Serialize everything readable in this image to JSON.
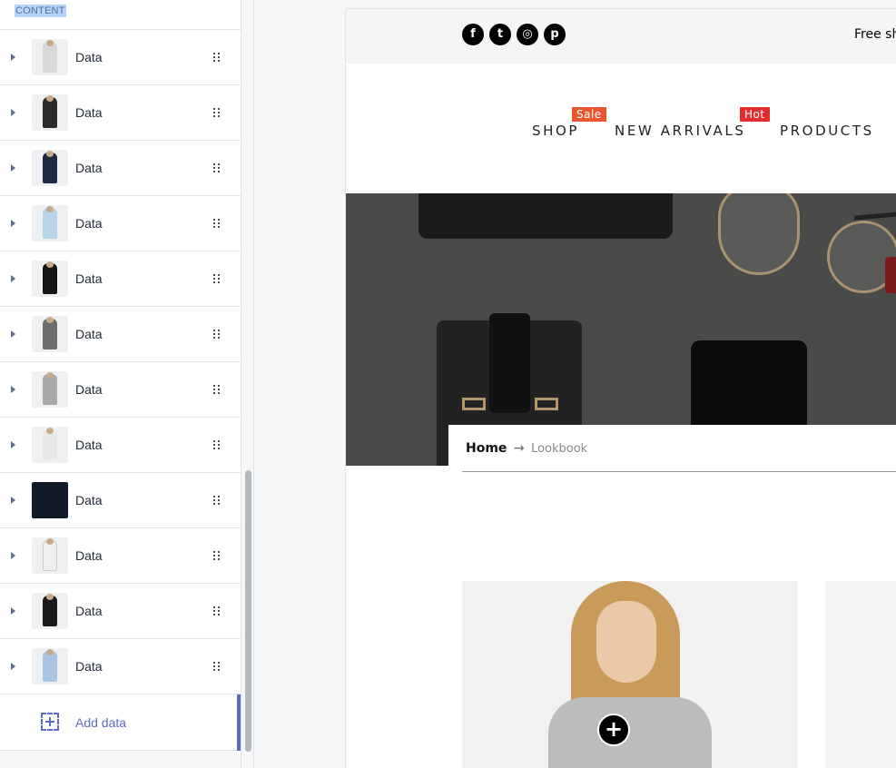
{
  "sidebar": {
    "header": "CONTENT",
    "items": [
      {
        "label": "Data",
        "thumb_color": "#d9d9d9"
      },
      {
        "label": "Data",
        "thumb_color": "#2a2a2a"
      },
      {
        "label": "Data",
        "thumb_color": "#1e2a44"
      },
      {
        "label": "Data",
        "thumb_color": "#b7d5ea"
      },
      {
        "label": "Data",
        "thumb_color": "#151515"
      },
      {
        "label": "Data",
        "thumb_color": "#6d6d6d"
      },
      {
        "label": "Data",
        "thumb_color": "#a9a9a9"
      },
      {
        "label": "Data",
        "thumb_color": "#e8e8e8"
      },
      {
        "label": "Data",
        "thumb_color": "#111827"
      },
      {
        "label": "Data",
        "thumb_color": "#efefef"
      },
      {
        "label": "Data",
        "thumb_color": "#1a1a1a"
      },
      {
        "label": "Data",
        "thumb_color": "#a8c6e0"
      }
    ],
    "add_label": "Add data"
  },
  "preview": {
    "social": [
      {
        "name": "facebook-icon",
        "glyph": "f"
      },
      {
        "name": "twitter-icon",
        "glyph": "t"
      },
      {
        "name": "instagram-icon",
        "glyph": "◎"
      },
      {
        "name": "pinterest-icon",
        "glyph": "p"
      }
    ],
    "announcement": "Free sh",
    "nav": {
      "shop": "SHOP",
      "shop_badge": "Sale",
      "new_arrivals": "NEW ARRIVALS",
      "new_badge": "Hot",
      "products": "PRODUCTS"
    },
    "breadcrumb": {
      "home": "Home",
      "arrow": "→",
      "current": "Lookbook"
    },
    "lookbook_plus": "+",
    "colors": {
      "sale_badge": "#e8572f",
      "hot_badge": "#e12d2d",
      "accent": "#5c6ac4"
    }
  }
}
